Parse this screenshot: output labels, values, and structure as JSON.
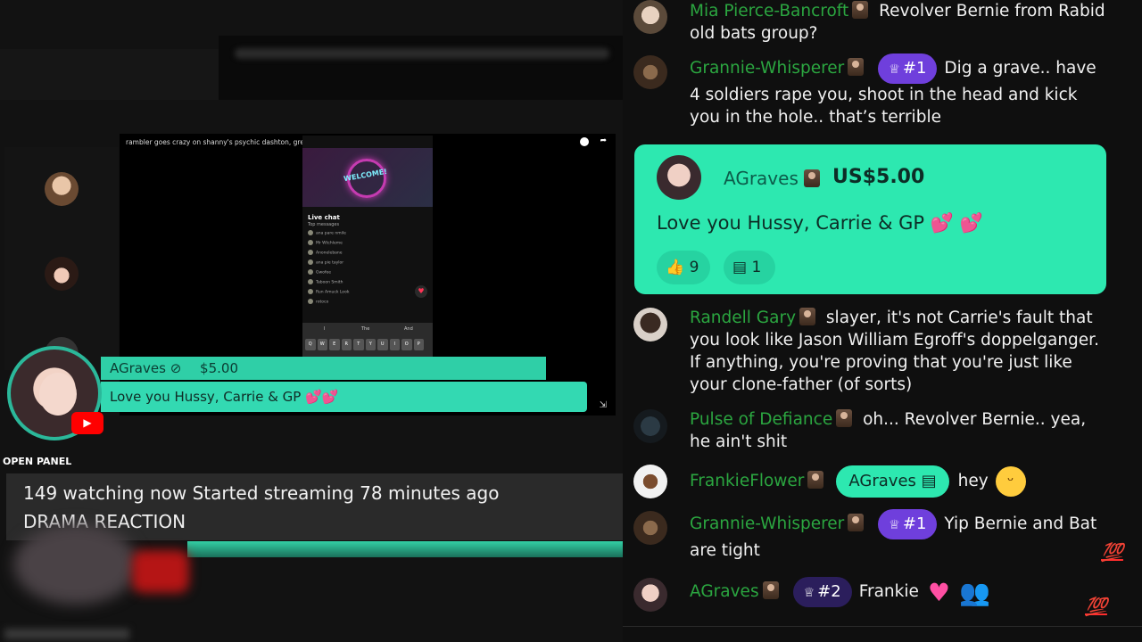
{
  "video": {
    "title": "rambler goes crazy on shanny's psychic dashton, greg banned (censored)",
    "phone": {
      "neon_text": "WELCOME!",
      "live_chat_title": "Live chat",
      "live_chat_sub": "Top messages",
      "rows": [
        "ana pare nmile",
        "Mr Wtchleme",
        "Anonelebane",
        "ana pie taylor",
        "Gwofee",
        "Taboon Smith",
        "Run Amuck Look",
        "rotoco"
      ],
      "keyboard_suggestions": [
        "I",
        "The",
        "And"
      ],
      "keys": [
        "Q",
        "W",
        "E",
        "R",
        "T",
        "Y",
        "U",
        "I",
        "O",
        "P"
      ]
    }
  },
  "donation_overlay": {
    "name": "AGraves",
    "amount": "$5.00",
    "message": "Love you Hussy, Carrie & GP 💕💕"
  },
  "open_panel_label": "OPEN PANEL",
  "stream_info": {
    "line1": "149 watching now  Started streaming 78 minutes ago",
    "line2": "DRAMA REACTION"
  },
  "chat": {
    "messages": [
      {
        "author": "Mia Pierce-Bancroft",
        "text": "Revolver Bernie from Rabid old bats group?"
      },
      {
        "author": "Grannie-Whisperer",
        "rank": "#1",
        "text": "Dig a grave.. have 4 soldiers rape you, shoot in the head and kick you in the hole.. that’s terrible"
      },
      {
        "author": "Randell Gary",
        "text": "slayer, it's not Carrie's fault that you look like Jason William Egroff's doppelganger. If anything, you're proving that you're just like your clone-father (of sorts)"
      },
      {
        "author": "Pulse of Defiance",
        "text": "oh... Revolver Bernie.. yea, he ain't shit"
      },
      {
        "author": "FrankieFlower",
        "reply_to": "AGraves",
        "text": "hey"
      },
      {
        "author": "Grannie-Whisperer",
        "rank": "#1",
        "text": "Yip Bernie and Bat are tight"
      },
      {
        "author": "AGraves",
        "rank": "#2",
        "text": "Frankie"
      }
    ],
    "superchat": {
      "author": "AGraves",
      "amount": "US$5.00",
      "message": "Love you Hussy, Carrie & GP 💕 💕",
      "likes": "9",
      "replies": "1"
    },
    "hundred_emoji": "💯",
    "colors": {
      "author": "#2ba640",
      "superchat": "#2de8b0",
      "rank_badge": "#6f3fdc"
    }
  }
}
